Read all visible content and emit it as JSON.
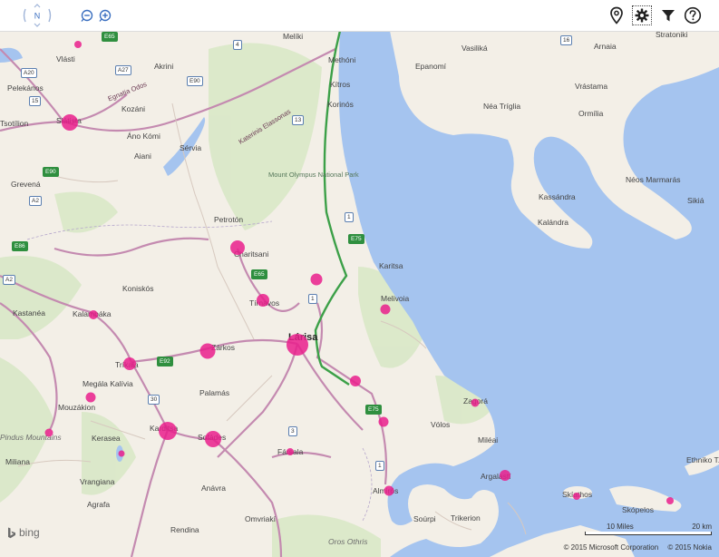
{
  "colors": {
    "sea": "#a5c4ef",
    "land": "#f3efe7",
    "forest": "#d7e7c5",
    "motorway": "#c48ab0",
    "green_road": "#3ca048",
    "marker": "#e91e8c"
  },
  "toolbar": {
    "nav_compass_label": "N",
    "zoom_out_icon": "zoom-out-icon",
    "zoom_in_icon": "zoom-in-icon",
    "location_icon": "map-pin-icon",
    "settings_icon": "gear-icon",
    "filter_icon": "filter-icon",
    "help_icon": "question-icon"
  },
  "places": {
    "vlasti": "Vlásti",
    "akrini": "Akrini",
    "pelekanos": "Pelekános",
    "tsotilion": "Tsotílion",
    "siatista": "Siátista",
    "kozani": "Kozáni",
    "ano_komi": "Áno Kómi",
    "aiani": "Aiani",
    "servia": "Sérvia",
    "grevena": "Grevená",
    "meliki": "Melíki",
    "methoni": "Methóni",
    "kitros": "Kítros",
    "korinos": "Korinós",
    "epanomi": "Epanomí",
    "vasilika": "Vasiliká",
    "arnaia": "Arnaia",
    "stratoniki": "Stratoniki",
    "nea_triglia": "Néa Tríglia",
    "vrastama": "Vrástama",
    "ormilia": "Ormília",
    "neos_marmaras": "Néos Marmarás",
    "sikia": "Sikiá",
    "kassandra": "Kassándra",
    "kalandra": "Kalándra",
    "petroton": "Petrotón",
    "elassona_road": "Katerinis Elassonas",
    "egnatia_road": "Egnatia Odos",
    "olympus_park": "Mount Olympus National Park",
    "charitsani": "Charitsani",
    "karitsa": "Karitsa",
    "melivoia": "Melivoia",
    "koniskos": "Koniskós",
    "kastanea": "Kastanéa",
    "kalambaka": "Kalambáka",
    "tirnavos": "Tírnavos",
    "larisa": "Lárisa",
    "zarkos": "Zárkos",
    "trikala": "Tríkala",
    "megala_kalivia": "Megála Kalívia",
    "mouzakion": "Mouzákion",
    "palamas": "Palamás",
    "karditsa": "Karditsa",
    "sofades": "Sofádes",
    "farsala": "Fársala",
    "kerasea": "Kerasea",
    "pindus": "Pindus Mountains",
    "miliana": "Miliana",
    "vrangiana": "Vrangiana",
    "agrafa": "Agrafa",
    "anavra": "Anávra",
    "omvriaki": "Omvriakí",
    "rendina": "Rendina",
    "othris": "Oros Othris",
    "sourpi": "Soúrpi",
    "trikerion": "Trikerion",
    "volos": "Vólos",
    "zagora": "Zagorá",
    "mileai": "Miléai",
    "argalasti": "Argalastí",
    "almiros": "Almirós",
    "skiathos": "Skíathos",
    "skopelos": "Skópelos",
    "ethniko": "Ethniko T..."
  },
  "shields": {
    "e90": "E90",
    "e65_a": "E65",
    "a27": "A27",
    "a20": "A20",
    "a2": "A2",
    "n15": "15",
    "n4": "4",
    "n13": "13",
    "n16": "16",
    "n1_a": "1",
    "e75_a": "E75",
    "e65_b": "E65",
    "n1_b": "1",
    "e92": "E92",
    "n30": "30",
    "n3": "3",
    "e75_b": "E75",
    "n1_c": "1",
    "e86": "E86",
    "a2_b": "A2"
  },
  "scale": {
    "miles_label": "10 Miles",
    "km_label": "20 km"
  },
  "attribution": {
    "microsoft": "© 2015 Microsoft Corporation",
    "nokia": "© 2015 Nokia"
  },
  "logo": {
    "text": "bing"
  }
}
